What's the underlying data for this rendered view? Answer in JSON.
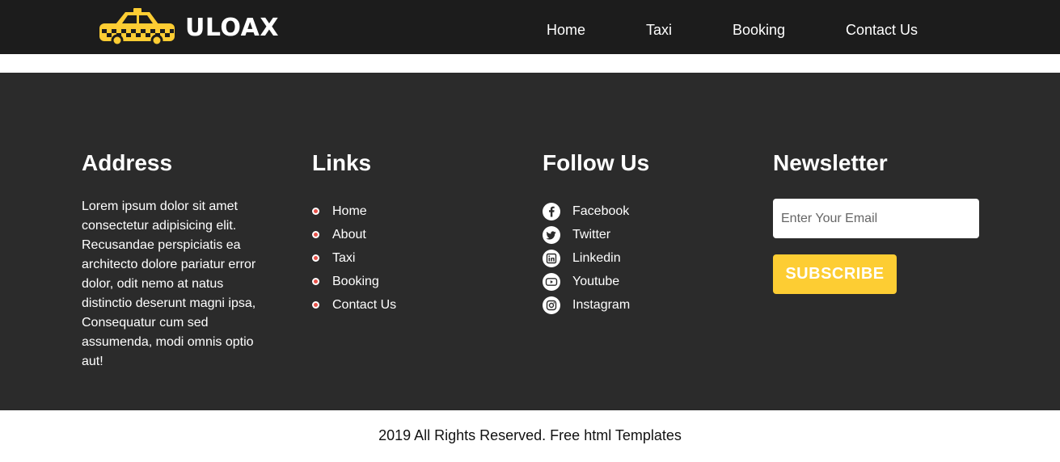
{
  "brand": {
    "name": "ULOAX",
    "icon": "taxi-logo-icon"
  },
  "nav": {
    "items": [
      {
        "label": "Home"
      },
      {
        "label": "Taxi"
      },
      {
        "label": "Booking"
      },
      {
        "label": "Contact Us"
      }
    ]
  },
  "footer": {
    "address": {
      "heading": "Address",
      "text": "Lorem ipsum dolor sit amet consectetur adipisicing elit. Recusandae perspiciatis ea architecto dolore pariatur error dolor, odit nemo at natus distinctio deserunt magni ipsa, Consequatur cum sed assumenda, modi omnis optio aut!"
    },
    "links": {
      "heading": "Links",
      "items": [
        {
          "label": "Home"
        },
        {
          "label": "About"
        },
        {
          "label": "Taxi"
        },
        {
          "label": "Booking"
        },
        {
          "label": "Contact Us"
        }
      ]
    },
    "follow": {
      "heading": "Follow Us",
      "items": [
        {
          "label": "Facebook",
          "icon": "facebook-icon"
        },
        {
          "label": "Twitter",
          "icon": "twitter-icon"
        },
        {
          "label": "Linkedin",
          "icon": "linkedin-icon"
        },
        {
          "label": "Youtube",
          "icon": "youtube-icon"
        },
        {
          "label": "Instagram",
          "icon": "instagram-icon"
        }
      ]
    },
    "newsletter": {
      "heading": "Newsletter",
      "email_placeholder": "Enter Your Email",
      "email_value": "",
      "subscribe_label": "SUBSCRIBE"
    }
  },
  "copyright": "2019 All Rights Reserved. Free html Templates",
  "colors": {
    "header_bg": "#1c1c1c",
    "footer_bg": "#2b2b2b",
    "accent_yellow": "#fdcd33",
    "bullet_red": "#e8524a"
  }
}
